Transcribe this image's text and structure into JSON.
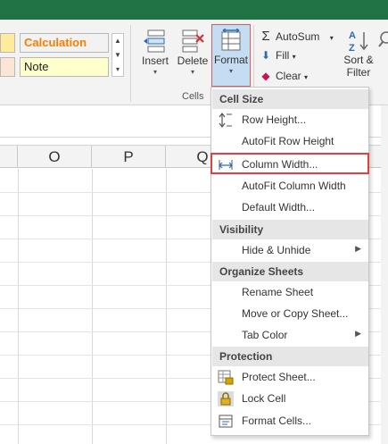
{
  "ribbon": {
    "styles": {
      "calculation": "Calculation",
      "note": "Note"
    },
    "cells_group": {
      "label": "Cells",
      "insert": "Insert",
      "delete": "Delete",
      "format": "Format"
    },
    "editing": {
      "autosum": "AutoSum",
      "fill": "Fill",
      "clear": "Clear",
      "sort_line1": "Sort &",
      "sort_line2": "Filter"
    }
  },
  "sheet": {
    "columns": [
      "O",
      "P",
      "Q"
    ]
  },
  "format_menu": {
    "sections": {
      "cell_size": "Cell Size",
      "visibility": "Visibility",
      "organize": "Organize Sheets",
      "protection": "Protection"
    },
    "items": {
      "row_height": "Row Height...",
      "autofit_row": "AutoFit Row Height",
      "column_width": "Column Width...",
      "autofit_column": "AutoFit Column Width",
      "default_width": "Default Width...",
      "hide_unhide": "Hide & Unhide",
      "rename_sheet": "Rename Sheet",
      "move_copy": "Move or Copy Sheet...",
      "tab_color": "Tab Color",
      "protect_sheet": "Protect Sheet...",
      "lock_cell": "Lock Cell",
      "format_cells": "Format Cells..."
    }
  },
  "colors": {
    "excel_green": "#217346",
    "highlight_red": "#e04040",
    "calculation_orange": "#fa7d00"
  }
}
